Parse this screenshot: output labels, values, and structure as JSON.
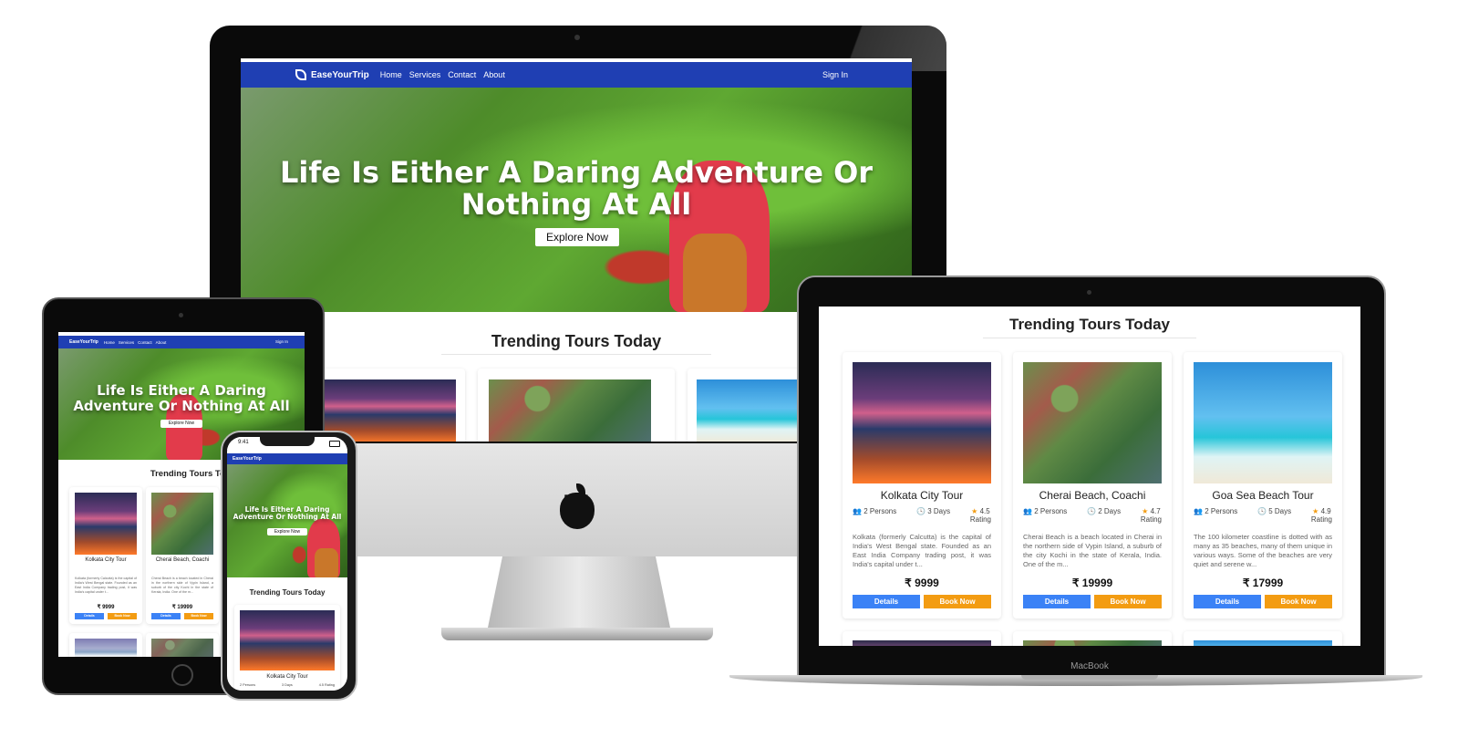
{
  "site": {
    "brand": "EaseYourTrip",
    "nav": [
      "Home",
      "Services",
      "Contact",
      "About"
    ],
    "sign_in": "Sign In",
    "hero_title": "Life Is Either A Daring Adventure Or Nothing At All",
    "explore": "Explore Now",
    "section_title": "Trending Tours Today",
    "colors": {
      "nav": "#1f3fb3",
      "details": "#3b82f6",
      "book": "#f39c12"
    }
  },
  "tours": [
    {
      "title": "Kolkata City Tour",
      "persons": "2 Persons",
      "days": "3 Days",
      "rating": "4.5",
      "rating_label": "Rating",
      "desc": "Kolkata (formerly Calcutta) is the capital of India's West Bengal state. Founded as an East India Company trading post, it was India's capital under t...",
      "price": "₹ 9999",
      "details": "Details",
      "book": "Book Now"
    },
    {
      "title": "Cherai Beach, Coachi",
      "persons": "2 Persons",
      "days": "2 Days",
      "rating": "4.7",
      "rating_label": "Rating",
      "desc": "Cherai Beach is a beach located in Cherai in the northern side of Vypin Island, a suburb of the city Kochi in the state of Kerala, India. One of the m...",
      "price": "₹ 19999",
      "details": "Details",
      "book": "Book Now"
    },
    {
      "title": "Goa Sea Beach Tour",
      "persons": "2 Persons",
      "days": "5 Days",
      "rating": "4.9",
      "rating_label": "Rating",
      "desc": "The 100 kilometer coastline is dotted with as many as 35 beaches, many of them unique in various ways. Some of the beaches are very quiet and serene w...",
      "price": "₹ 17999",
      "details": "Details",
      "book": "Book Now"
    }
  ],
  "phone_status": {
    "time": "9:41"
  },
  "phone_meta": {
    "rating_inline": "4.5 Rating"
  },
  "laptop_label": "MacBook"
}
